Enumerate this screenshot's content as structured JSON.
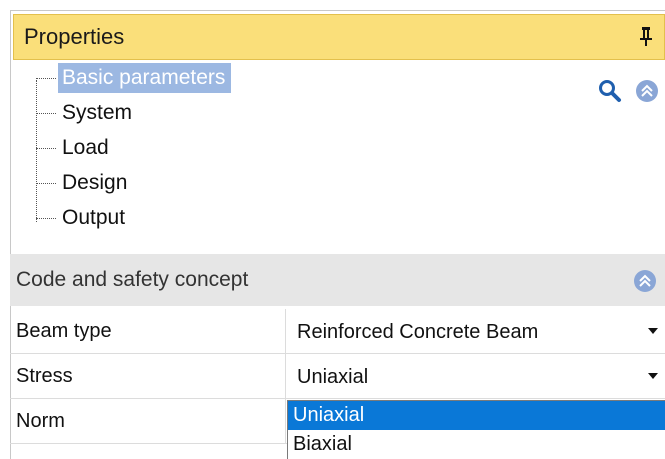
{
  "panel": {
    "title": "Properties"
  },
  "tree": {
    "items": [
      {
        "label": "Basic parameters",
        "selected": true
      },
      {
        "label": "System"
      },
      {
        "label": "Load"
      },
      {
        "label": "Design"
      },
      {
        "label": "Output"
      }
    ]
  },
  "section": {
    "title": "Code and safety concept"
  },
  "properties": [
    {
      "name": "Beam type",
      "value": "Reinforced Concrete Beam"
    },
    {
      "name": "Stress",
      "value": "Uniaxial"
    },
    {
      "name": "Norm",
      "value": ""
    }
  ],
  "dropdown": {
    "options": [
      "Uniaxial",
      "Biaxial"
    ],
    "highlighted": "Uniaxial"
  },
  "colors": {
    "title_bar": "#fadf7a",
    "tree_selection": "#9cb8e2",
    "dropdown_highlight": "#0a78d7",
    "section_header": "#e6e6e6"
  },
  "icons": [
    "pin-icon",
    "search-icon",
    "collapse-up-icon",
    "dropdown-arrow-icon"
  ]
}
